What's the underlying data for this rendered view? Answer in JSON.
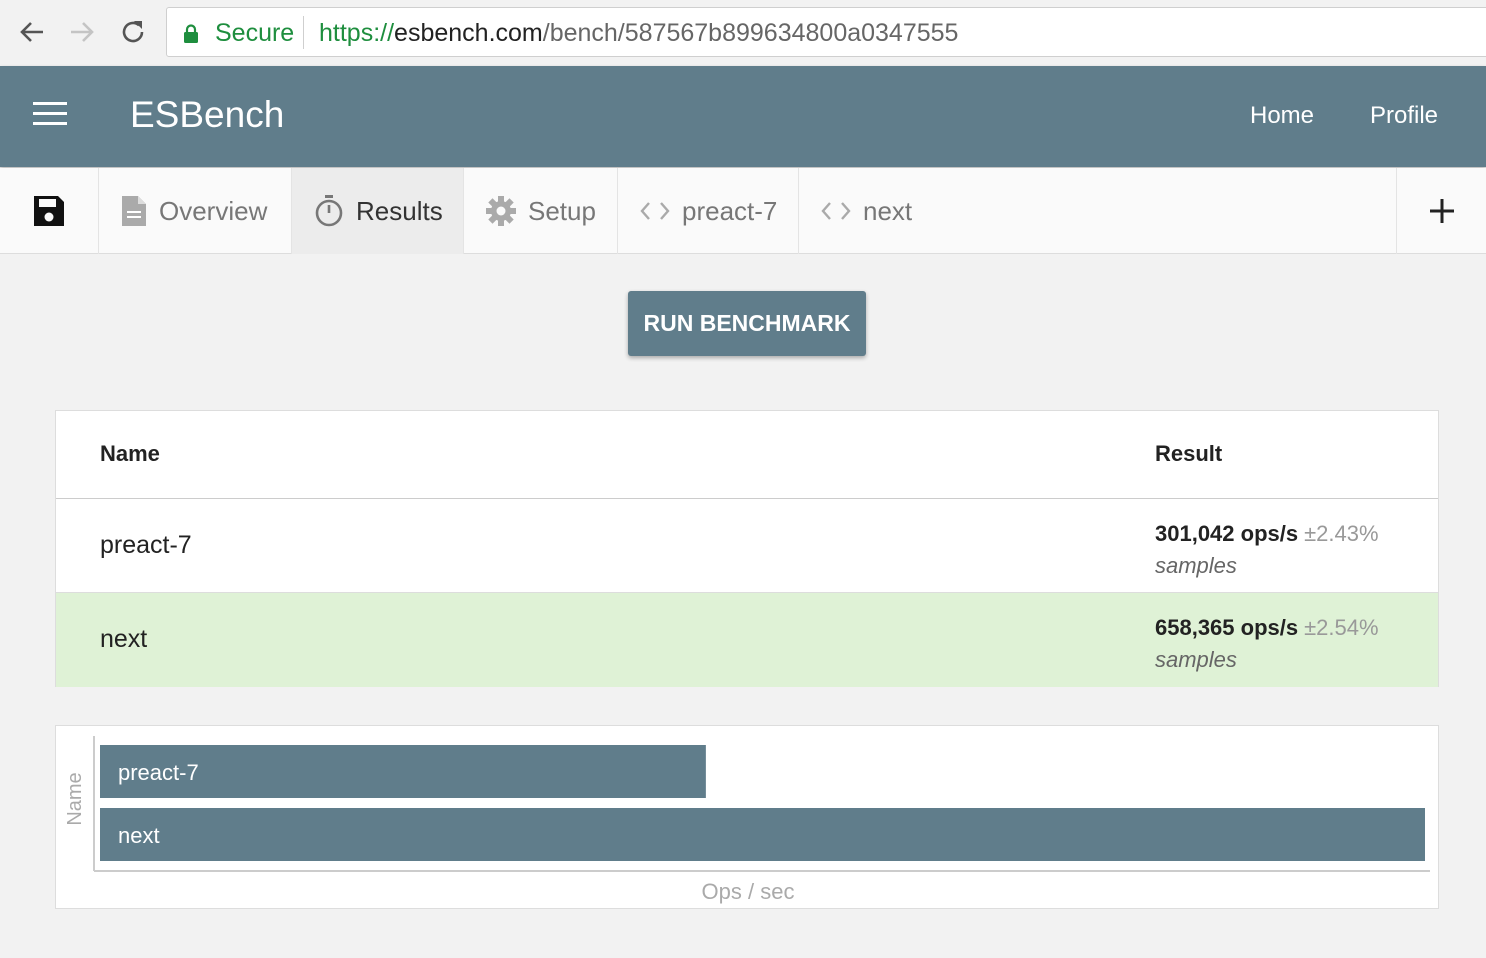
{
  "browser": {
    "secure_label": "Secure",
    "url_scheme": "https://",
    "url_host": "esbench.com",
    "url_path": "/bench/587567b899634800a0347555"
  },
  "header": {
    "brand": "ESBench",
    "links": [
      "Home",
      "Profile"
    ]
  },
  "tabs": [
    {
      "label": "Overview",
      "icon": "document-icon",
      "active": false
    },
    {
      "label": "Results",
      "icon": "stopwatch-icon",
      "active": true
    },
    {
      "label": "Setup",
      "icon": "gear-icon",
      "active": false
    },
    {
      "label": "preact-7",
      "icon": "code-icon",
      "active": false
    },
    {
      "label": "next",
      "icon": "code-icon",
      "active": false
    }
  ],
  "run_button_label": "RUN BENCHMARK",
  "table": {
    "headers": {
      "name": "Name",
      "result": "Result"
    },
    "rows": [
      {
        "name": "preact-7",
        "ops": "301,042 ops/s",
        "margin": "±2.43%",
        "samples": "samples",
        "winner": false
      },
      {
        "name": "next",
        "ops": "658,365 ops/s",
        "margin": "±2.54%",
        "samples": "samples",
        "winner": true
      }
    ]
  },
  "chart_data": {
    "type": "bar",
    "orientation": "horizontal",
    "categories": [
      "preact-7",
      "next"
    ],
    "values": [
      301042,
      658365
    ],
    "xlabel": "Ops / sec",
    "ylabel": "Name",
    "bar_color": "#607d8b"
  },
  "colors": {
    "accent": "#607d8b",
    "winner_row": "#dff2d6",
    "secure": "#1e8e3e"
  }
}
